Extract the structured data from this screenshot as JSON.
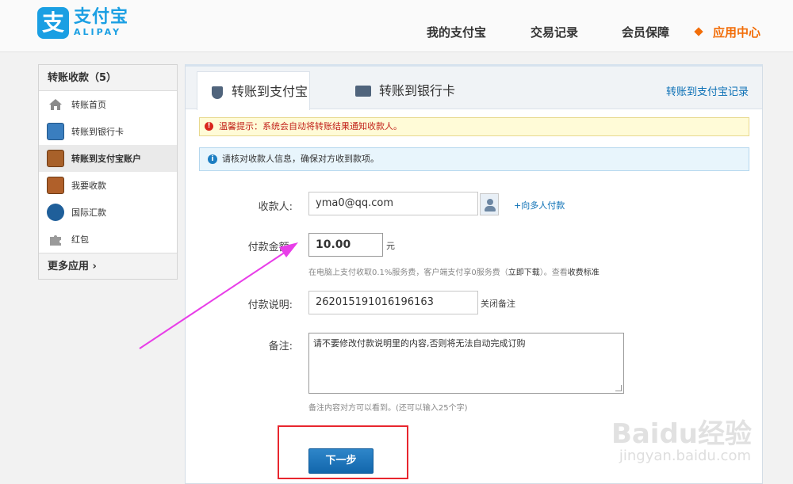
{
  "header": {
    "logo_cn": "支付宝",
    "logo_en": "ALIPAY",
    "nav": [
      "我的支付宝",
      "交易记录",
      "会员保障",
      "应用中心"
    ]
  },
  "sidebar": {
    "title": "转账收款（5）",
    "items": [
      {
        "label": "转账首页",
        "icon": "home-icon",
        "color": "#8a8a8a"
      },
      {
        "label": "转账到银行卡",
        "icon": "bank-card-icon",
        "color": "#3a7ebf"
      },
      {
        "label": "转账到支付宝账户",
        "icon": "alipay-transfer-icon",
        "color": "#a8612a"
      },
      {
        "label": "我要收款",
        "icon": "receive-money-icon",
        "color": "#b0602a"
      },
      {
        "label": "国际汇款",
        "icon": "globe-icon",
        "color": "#1f5f9a"
      },
      {
        "label": "红包",
        "icon": "puzzle-icon",
        "color": "#9a9a9a"
      }
    ],
    "footer": "更多应用 ›"
  },
  "tabs": {
    "alipay": "转账到支付宝",
    "bank": "转账到银行卡",
    "record_link": "转账到支付宝记录"
  },
  "notices": {
    "warning": "温馨提示：系统会自动将转账结果通知收款人。",
    "info": "请核对收款人信息，确保对方收到款项。"
  },
  "form": {
    "payee_label": "收款人:",
    "payee_value": "yma0@qq.com",
    "multi_payee": "+向多人付款",
    "amount_label": "付款金额:",
    "amount_value": "10.00",
    "amount_unit": "元",
    "fee_note": "在电脑上支付收取0.1%服务费，客户端支付享0服务费（",
    "fee_download": "立即下载",
    "fee_note_tail": "）。查看",
    "fee_standard": "收费标准",
    "desc_label": "付款说明:",
    "desc_value": "262015191016196163",
    "close_note": "关闭备注",
    "remark_label": "备注:",
    "remark_value": "请不要修改付款说明里的内容,否则将无法自动完成订购",
    "remark_hint": "备注内容对方可以看到。(还可以输入25个字)",
    "next_button": "下一步"
  },
  "watermark": {
    "line1": "Baidu经验",
    "line2": "jingyan.baidu.com"
  },
  "colors": {
    "brand": "#1a9fe3",
    "accent": "#f26d08",
    "link": "#0a6fb5",
    "annotation_arrow": "#e83ee8",
    "annotation_box": "#e8262e"
  }
}
